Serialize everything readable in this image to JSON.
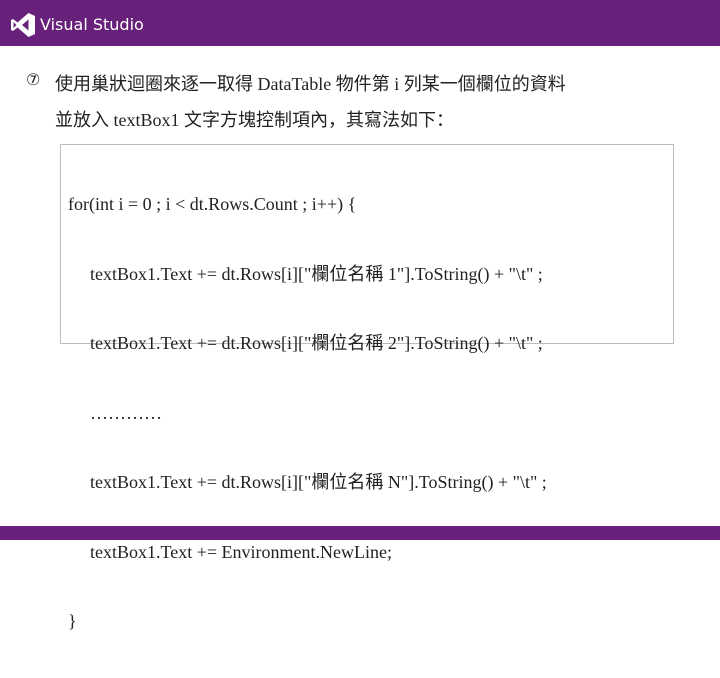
{
  "header": {
    "brand_name": "Visual Studio",
    "logo_icon": "visual-studio-logo-icon",
    "color": "#68217a"
  },
  "content": {
    "bullet": "⑦",
    "paragraph_lines": [
      "使用巢狀迴圈來逐一取得 DataTable 物件第 i 列某一個欄位的資料",
      "並放入 textBox1 文字方塊控制項內，其寫法如下："
    ],
    "code_lines": [
      "for(int i = 0 ; i < dt.Rows.Count ; i++) {",
      "textBox1.Text += dt.Rows[i][\"欄位名稱 1\"].ToString() + \"\\t\" ;",
      "textBox1.Text += dt.Rows[i][\"欄位名稱 2\"].ToString() + \"\\t\" ;",
      "…………",
      "textBox1.Text += dt.Rows[i][\"欄位名稱 N\"].ToString() + \"\\t\" ;",
      "textBox1.Text += Environment.NewLine;",
      "}"
    ]
  },
  "footer": {
    "color": "#68217a"
  }
}
